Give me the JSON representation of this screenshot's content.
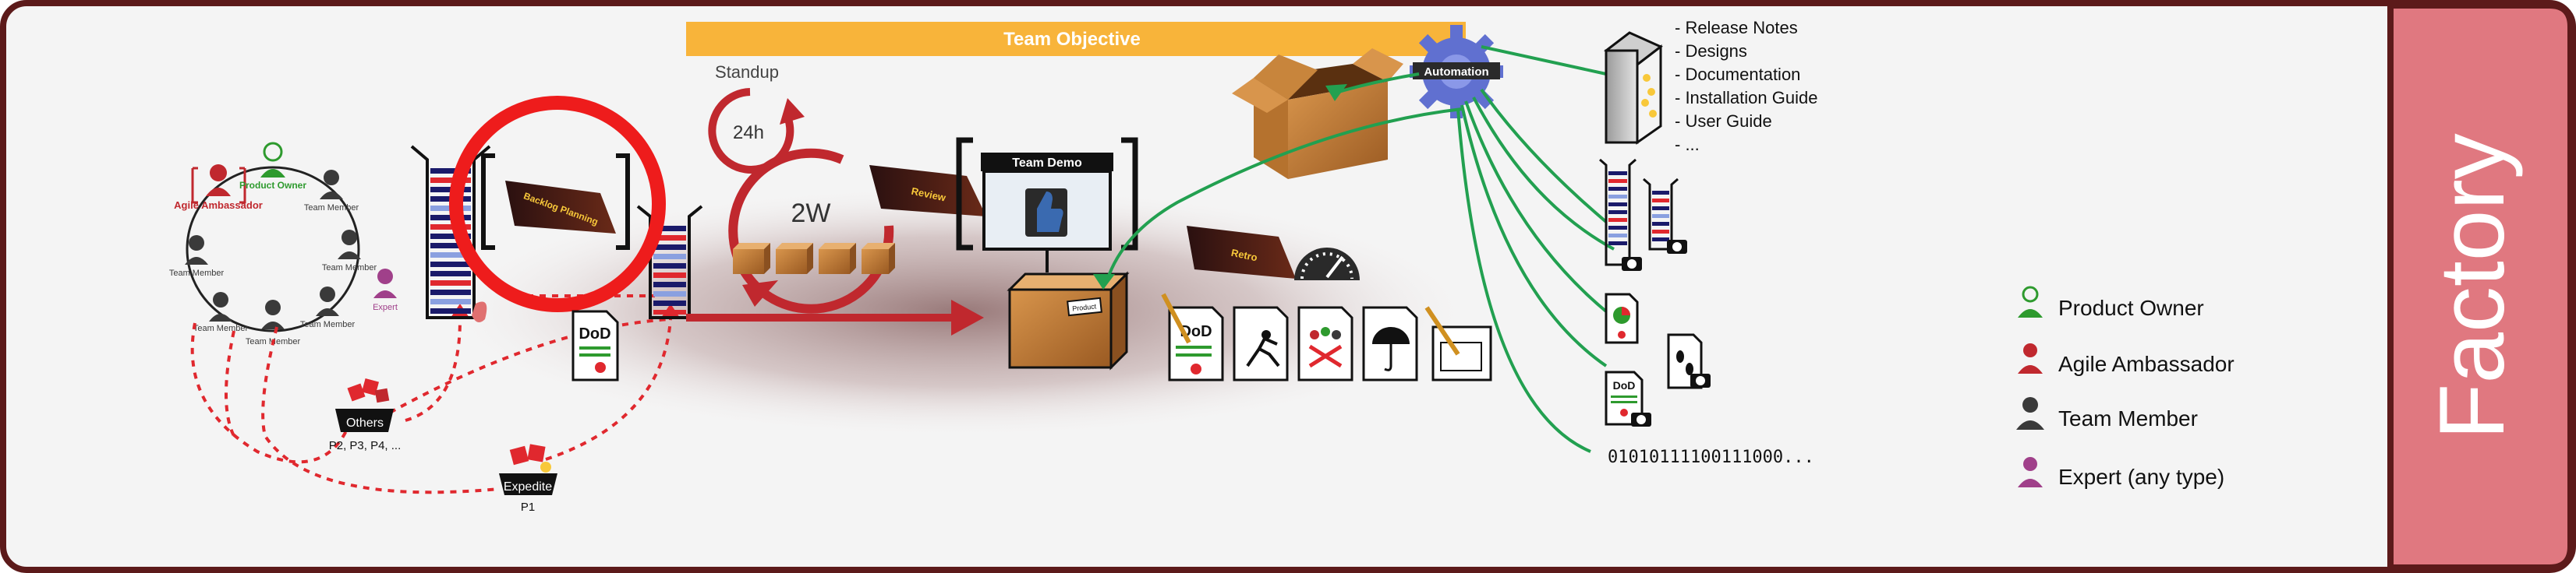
{
  "objective": "Team Objective",
  "standup": "Standup",
  "daily": "24h",
  "sprint": "2W",
  "team_demo": "Team Demo",
  "automation": "Automation",
  "dod": "DoD",
  "labels": {
    "backlog_planning": "Backlog Planning",
    "review": "Review",
    "retro": "Retro",
    "box_tag": "Product"
  },
  "roles": {
    "agile_ambassador": "Agile Ambassador",
    "product_owner": "Product Owner",
    "team_member": "Team Member",
    "expert": "Expert"
  },
  "buckets": {
    "others": "Others",
    "others_priority": "P2, P3, P4, ...",
    "expedite": "Expedite",
    "expedite_priority": "P1"
  },
  "deliverables": [
    "- Release Notes",
    "- Designs",
    "- Documentation",
    "- Installation Guide",
    "- User Guide",
    "- ..."
  ],
  "binary": "01010111100111000...",
  "legend": [
    {
      "label": "Product Owner",
      "color": "#2e9a2e",
      "icon": "product-owner-icon"
    },
    {
      "label": "Agile Ambassador",
      "color": "#c0282e",
      "icon": "agile-ambassador-icon"
    },
    {
      "label": "Team Member",
      "color": "#3a3a3a",
      "icon": "team-member-icon"
    },
    {
      "label": "Expert (any type)",
      "color": "#a0408a",
      "icon": "expert-icon"
    }
  ],
  "side_title": "Factory",
  "colors": {
    "frame": "#5c1a1a",
    "side_panel": "#e07880",
    "objective_bar": "#f8b43a",
    "red": "#c0282e",
    "green": "#22a050",
    "gear": "#6070d0"
  }
}
